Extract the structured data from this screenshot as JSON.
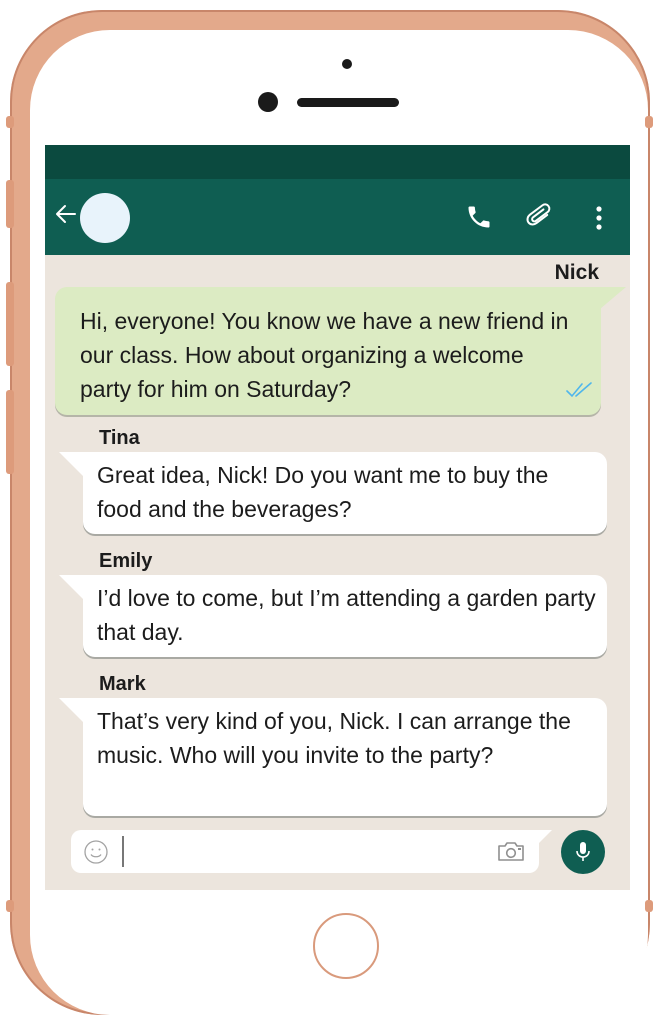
{
  "header": {
    "back_icon": "back-arrow-icon",
    "avatar": "contact-avatar",
    "actions": [
      "call-icon",
      "attach-icon",
      "more-options-icon"
    ]
  },
  "chat": {
    "messages": [
      {
        "sender": "Nick",
        "direction": "outgoing",
        "text": "Hi, everyone! You know we have a new friend in our class. How about organizing a welcome party for him on Saturday?",
        "status_icon": "double-check-icon"
      },
      {
        "sender": "Tina",
        "direction": "incoming",
        "text": "Great idea, Nick! Do you want me to buy the food and the beverages?"
      },
      {
        "sender": "Emily",
        "direction": "incoming",
        "text": "I’d love to come, but I’m attending a garden party that day."
      },
      {
        "sender": "Mark",
        "direction": "incoming",
        "text": "That’s very kind of you, Nick. I can arrange the music. Who will you invite to the party?"
      }
    ]
  },
  "composer": {
    "value": "",
    "emoji_icon": "emoji-icon",
    "camera_icon": "camera-icon",
    "mic_icon": "mic-icon"
  },
  "colors": {
    "frame": "#e3a98b",
    "status_bar": "#0b4a3f",
    "app_bar": "#0f5e52",
    "chat_background": "#ece5dd",
    "outgoing_bubble": "#dcebc3",
    "incoming_bubble": "#ffffff",
    "read_tick": "#4fb6ec"
  }
}
